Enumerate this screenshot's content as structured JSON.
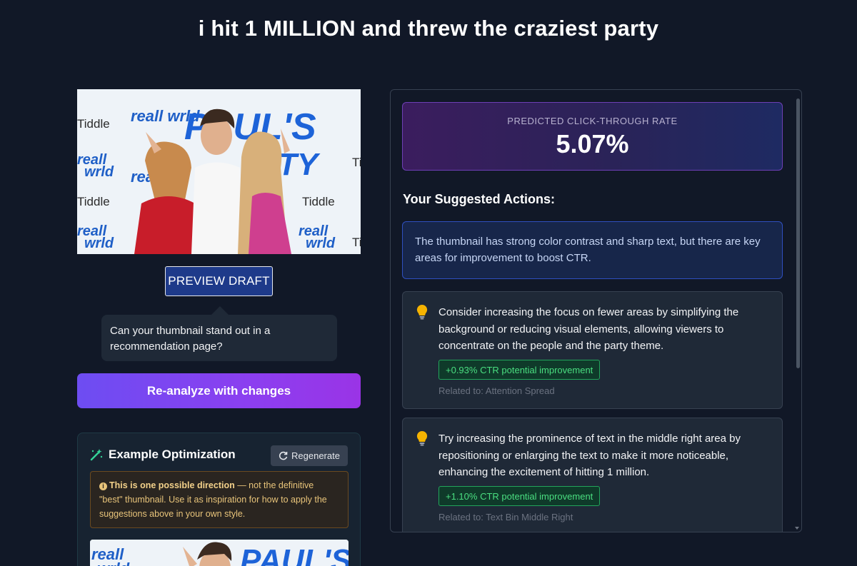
{
  "page": {
    "title": "i hit 1 MILLION and threw the craziest party"
  },
  "thumbnail": {
    "alt_words": [
      "reall wrld",
      "Tiddle",
      "PAUL'S PARTY"
    ]
  },
  "preview": {
    "button_label": "PREVIEW DRAFT"
  },
  "tooltip": {
    "text": "Can your thumbnail stand out in a recommendation page?"
  },
  "reanalyze": {
    "label": "Re-analyze with changes"
  },
  "example": {
    "title": "Example Optimization",
    "regenerate_label": "Regenerate",
    "note_bold": "This is one possible direction",
    "note_rest": " — not the definitive \"best\" thumbnail. Use it as inspiration for how to apply the suggestions above in your own style."
  },
  "ctr": {
    "label": "PREDICTED CLICK-THROUGH RATE",
    "value": "5.07%"
  },
  "actions": {
    "title": "Your Suggested Actions:",
    "summary": "The thumbnail has strong color contrast and sharp text, but there are key areas for improvement to boost CTR.",
    "items": [
      {
        "text": "Consider increasing the focus on fewer areas by simplifying the background or reducing visual elements, allowing viewers to concentrate on the people and the party theme.",
        "impact": "+0.93% CTR potential improvement",
        "related": "Related to: Attention Spread"
      },
      {
        "text": "Try increasing the prominence of text in the middle right area by repositioning or enlarging the text to make it more noticeable, enhancing the excitement of hitting 1 million.",
        "impact": "+1.10% CTR potential improvement",
        "related": "Related to: Text Bin Middle Right"
      }
    ]
  },
  "colors": {
    "background": "#111827",
    "accent_gradient_start": "#6d4df2",
    "accent_gradient_end": "#9a34e6",
    "impact_green": "#4ade80",
    "warning_text": "#e8c47a"
  },
  "icons": [
    "wand-sparkles-icon",
    "refresh-icon",
    "info-icon",
    "lightbulb-icon"
  ]
}
